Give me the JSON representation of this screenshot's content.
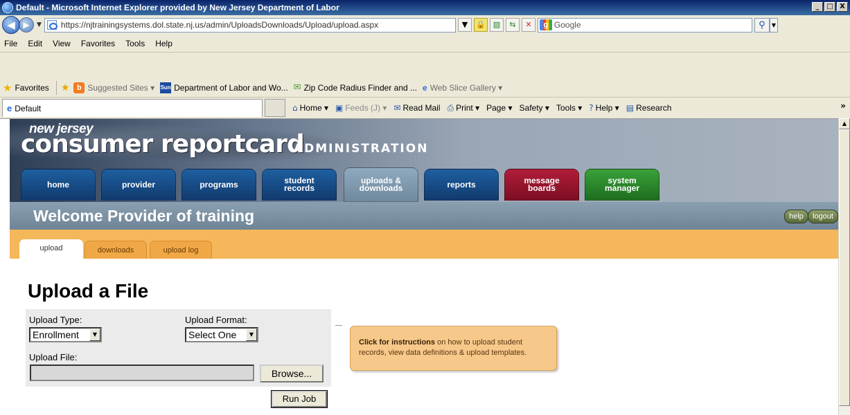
{
  "window": {
    "title": "Default - Microsoft Internet Explorer provided by New Jersey Department of Labor",
    "buttons": [
      "_",
      "□",
      "X"
    ]
  },
  "address": {
    "url": "https://njtrainingsystems.dol.state.nj.us/admin/UploadsDownloads/Upload/upload.aspx",
    "search_placeholder": "Google"
  },
  "menu": [
    "File",
    "Edit",
    "View",
    "Favorites",
    "Tools",
    "Help"
  ],
  "favorites": {
    "label": "Favorites",
    "items": [
      {
        "label": "Suggested Sites ▾",
        "dim": true
      },
      {
        "label": "Department of Labor and Wo...",
        "dim": false
      },
      {
        "label": "Zip Code Radius Finder and ...",
        "dim": false
      },
      {
        "label": "Web Slice Gallery ▾",
        "dim": true
      }
    ]
  },
  "tab": {
    "label": "Default"
  },
  "commands": [
    {
      "label": "Home ▾",
      "dim": false
    },
    {
      "label": "Feeds (J) ▾",
      "dim": true
    },
    {
      "label": "Read Mail",
      "dim": false
    },
    {
      "label": "Print ▾",
      "dim": false
    },
    {
      "label": "Page ▾",
      "dim": false
    },
    {
      "label": "Safety ▾",
      "dim": false
    },
    {
      "label": "Tools ▾",
      "dim": false
    },
    {
      "label": "Help ▾",
      "dim": false
    },
    {
      "label": "Research",
      "dim": false
    }
  ],
  "site": {
    "brand_small": "new jersey",
    "brand_big": "consumer reportcard",
    "brand_admin": "ADMINISTRATION",
    "nav": [
      {
        "line1": "home",
        "line2": ""
      },
      {
        "line1": "provider",
        "line2": ""
      },
      {
        "line1": "programs",
        "line2": ""
      },
      {
        "line1": "student",
        "line2": "records"
      },
      {
        "line1": "uploads &",
        "line2": "downloads"
      },
      {
        "line1": "reports",
        "line2": ""
      },
      {
        "line1": "message",
        "line2": "boards"
      },
      {
        "line1": "system",
        "line2": "manager"
      }
    ],
    "welcome": "Welcome Provider of training",
    "help_label": "help",
    "logout_label": "logout",
    "subtabs": [
      "upload",
      "downloads",
      "upload log"
    ]
  },
  "page": {
    "title": "Upload a File",
    "upload_type_label": "Upload Type:",
    "upload_type_value": "Enrollment",
    "upload_format_label": "Upload Format:",
    "upload_format_value": "Select One",
    "upload_file_label": "Upload File:",
    "browse_label": "Browse...",
    "run_job_label": "Run Job",
    "instructions_bold": "Click for instructions",
    "instructions_text": " on how to upload student records, view data definitions & upload templates."
  }
}
